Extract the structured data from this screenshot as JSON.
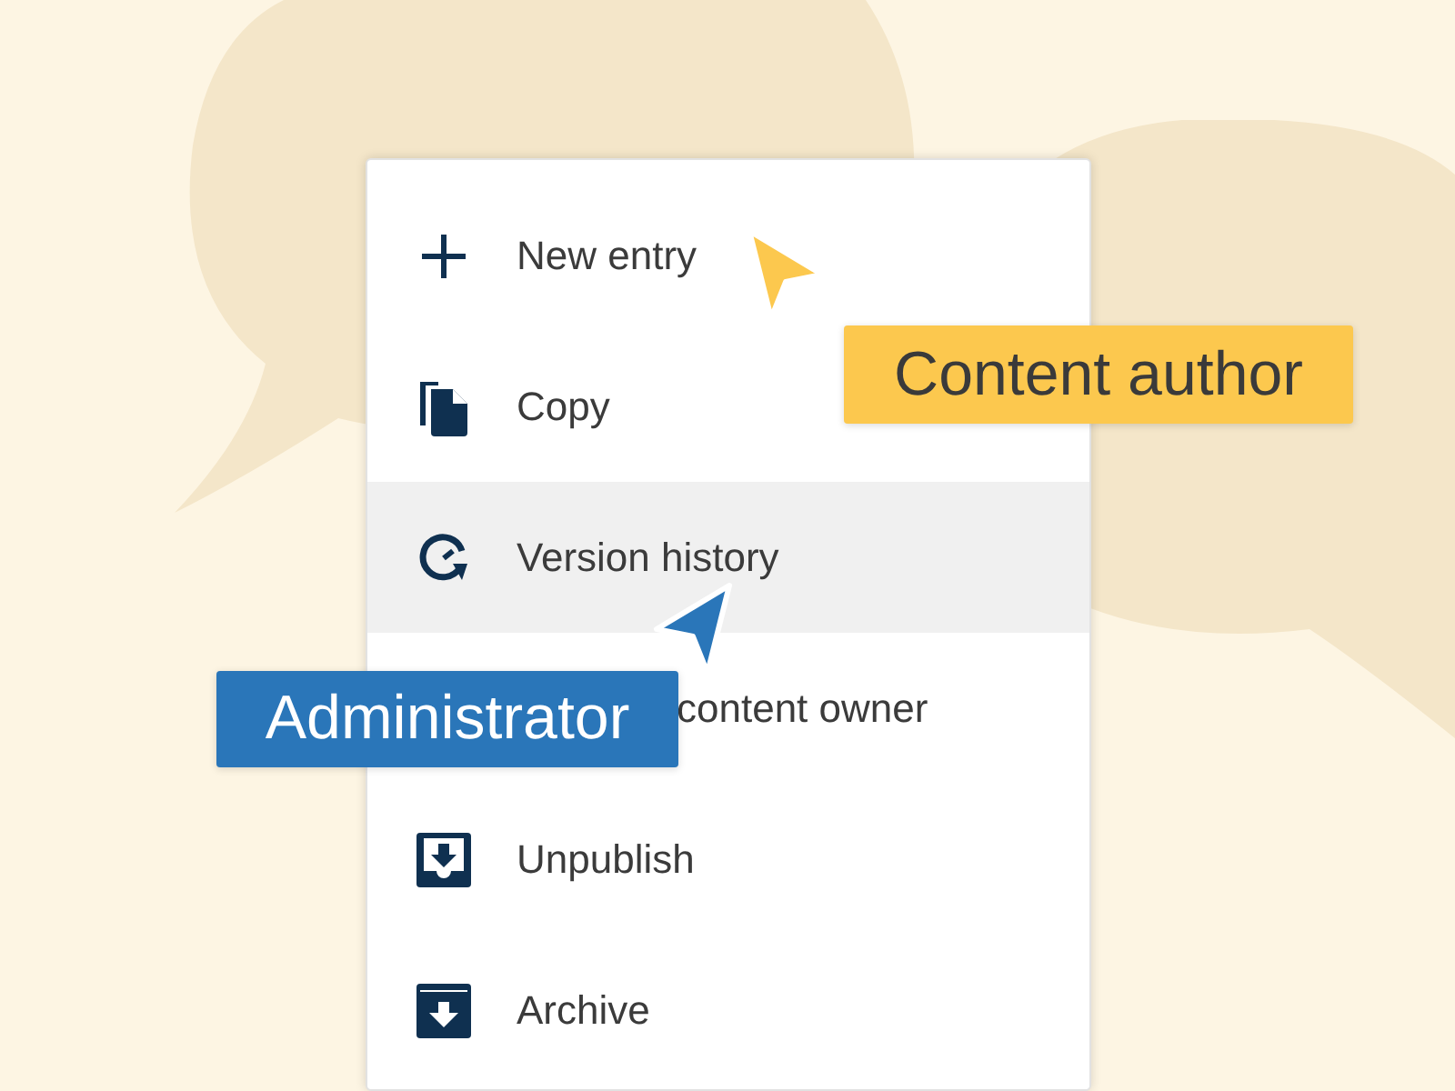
{
  "menu": {
    "items": [
      {
        "kind": "add",
        "label": "New entry",
        "highlighted": false
      },
      {
        "kind": "copy",
        "label": "Copy",
        "highlighted": false
      },
      {
        "kind": "history",
        "label": "Version history",
        "highlighted": true
      },
      {
        "kind": "covered",
        "label": "content owner",
        "highlighted": false
      },
      {
        "kind": "unpublish",
        "label": "Unpublish",
        "highlighted": false
      },
      {
        "kind": "archive",
        "label": "Archive",
        "highlighted": false
      }
    ]
  },
  "cursors": [
    {
      "kind": "author",
      "label": "Content author",
      "color": "#fcc84e"
    },
    {
      "kind": "admin",
      "label": "Administrator",
      "color": "#2a76b9"
    }
  ]
}
